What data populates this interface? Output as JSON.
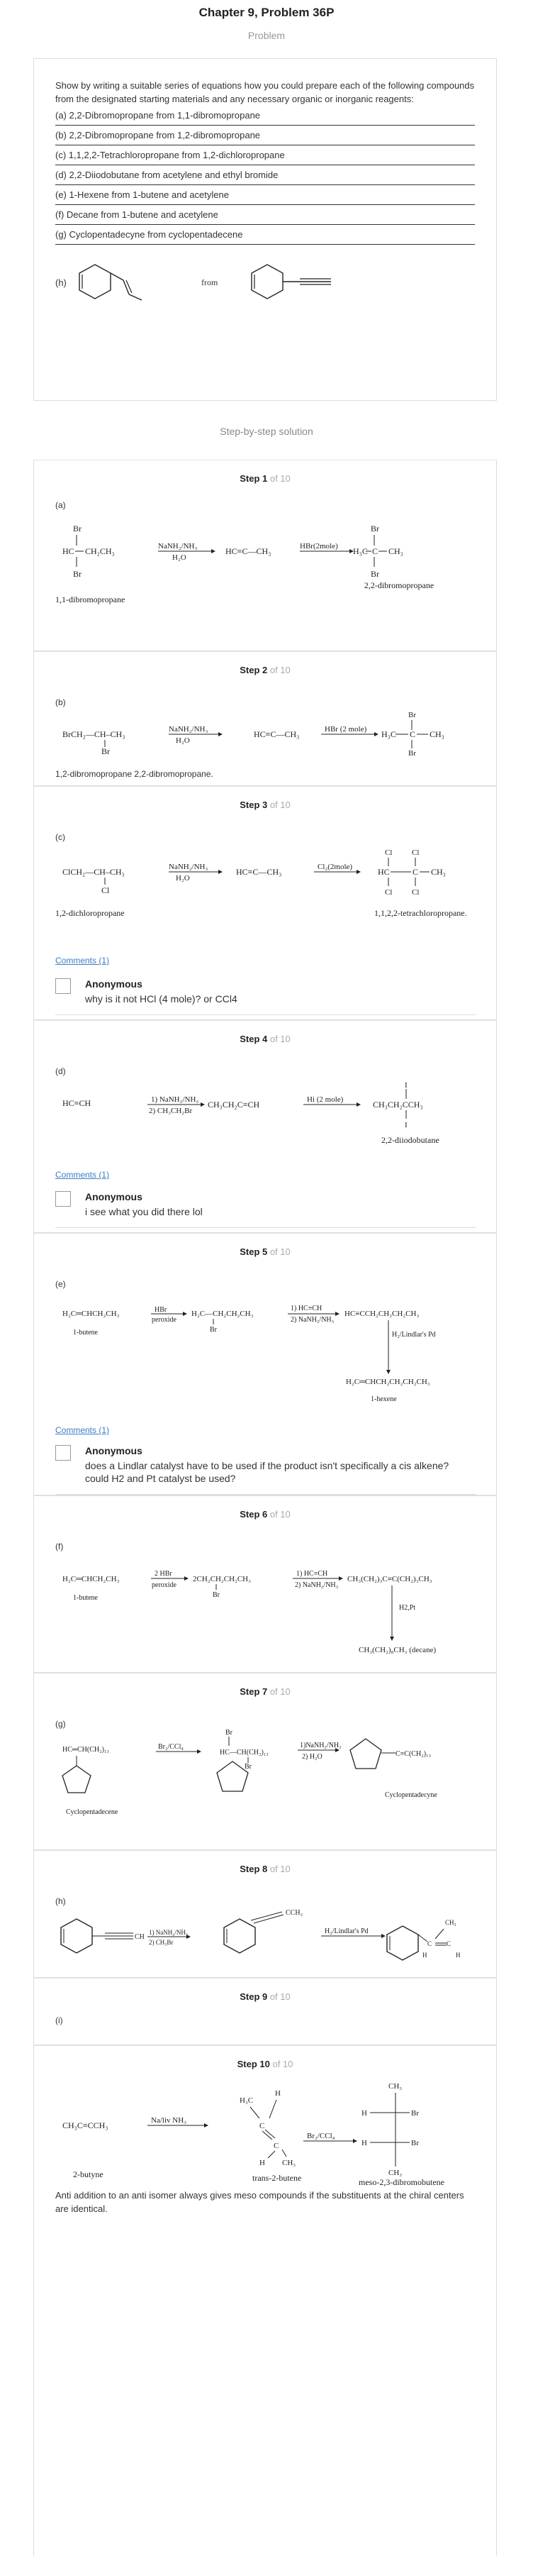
{
  "header": {
    "title": "Chapter 9, Problem 36P",
    "subtitle": "Problem"
  },
  "problem": {
    "intro": "Show by writing a suitable series of equations how you could prepare each of the following compounds from the designated starting materials and any necessary organic or inorganic reagents:",
    "questions": [
      "(a) 2,2-Dibromopropane from 1,1-dibromopropane",
      "(b) 2,2-Dibromopropane from 1,2-dibromopropane",
      "(c) 1,1,2,2-Tetrachloropropane from 1,2-dichloropropane",
      "(d) 2,2-Diiodobutane from acetylene and ethyl bromide",
      "(e) 1-Hexene from 1-butene and acetylene",
      "(f) Decane from 1-butene and acetylene",
      "(g) Cyclopentadecyne from cyclopentadecene"
    ],
    "h_label": "(h)",
    "h_from": "from"
  },
  "solution_title": "Step-by-step solution",
  "steps": [
    {
      "num": "Step 1",
      "of": " of 10",
      "part": "(a)"
    },
    {
      "num": "Step 2",
      "of": " of 10",
      "part": "(b)"
    },
    {
      "num": "Step 3",
      "of": " of 10",
      "part": "(c)"
    },
    {
      "num": "Step 4",
      "of": " of 10",
      "part": "(d)"
    },
    {
      "num": "Step 5",
      "of": " of 10",
      "part": "(e)"
    },
    {
      "num": "Step 6",
      "of": " of 10",
      "part": "(f)"
    },
    {
      "num": "Step 7",
      "of": " of 10",
      "part": "(g)"
    },
    {
      "num": "Step 8",
      "of": " of 10",
      "part": "(h)"
    },
    {
      "num": "Step 9",
      "of": " of 10",
      "part": "(i)"
    },
    {
      "num": "Step 10",
      "of": " of 10",
      "part": ""
    }
  ],
  "step1": {
    "reagent1_top": "NaNH₂/NH₃",
    "reagent1_bottom": "H₂O",
    "reagent2": "HBr(2mole)",
    "start_name": "1,1-dibromopropane",
    "end_name": "2,2-dibromopropane",
    "br": "Br",
    "hc": "HC",
    "chain": "CH₂CH₃",
    "alkyne": "HC≡C—CH₃",
    "h3c": "H₃C",
    "c": "C",
    "ch3": "CH₃"
  },
  "step2": {
    "start": "BrCH₂—CH–CH₃",
    "br": "Br",
    "reagent1_top": "NaNH₂/NH₃",
    "reagent1_bottom": "H₂O",
    "alkyne": "HC≡C—CH₃",
    "reagent2": "HBr (2 mole)",
    "h3c": "H₃C",
    "c": "C",
    "ch3": "CH₃",
    "caption": "1,2-dibromopropane 2,2-dibromopropane."
  },
  "step3": {
    "start": "ClCH₂—CH–CH₃",
    "cl": "Cl",
    "reagent1_top": "NaNH₂/NH₃",
    "reagent1_bottom": "H₂O",
    "alkyne": "HC≡C—CH₃",
    "reagent2": "Cl₂(2mole)",
    "hc": "HC",
    "c": "C",
    "ch3": "CH₃",
    "start_name": "1,2-dichloropropane",
    "end_name": "1,1,2,2-tetrachloropropane.",
    "comments_link": "Comments (1)",
    "comment_author": "Anonymous",
    "comment_text": "why is it not HCl (4 mole)? or CCl4"
  },
  "step4": {
    "start": "HC≡CH",
    "reagent1_top": "1) NaNH₂/NH₃",
    "reagent1_bottom": "2) CH₃CH₂Br",
    "mid": "CH₃CH₂C≡CH",
    "reagent2": "Hi (2 mole)",
    "product": "CH₃CH₂CCH₃",
    "i": "I",
    "end_name": "2,2-diiodobutane",
    "comments_link": "Comments (1)",
    "comment_author": "Anonymous",
    "comment_text": "i see what you did there lol"
  },
  "step5": {
    "start": "H₂C═CHCH₂CH₃",
    "start_name": "1-butene",
    "reagent1_top": "HBr",
    "reagent1_bottom": "peroxide",
    "mid": "H₂C—CH₂CH₂CH₃",
    "br": "Br",
    "reagent2_top": "1) HC≡CH",
    "reagent2_bottom": "2) NaNH₂/NH₃",
    "alkyne": "HC≡CCH₂CH₂CH₂CH₃",
    "reagent3": "H₂/Lindlar's Pd",
    "product": "H₂C═CHCH₂CH₂CH₂CH₃",
    "end_name": "1-hexene",
    "comments_link": "Comments (1)",
    "comment_author": "Anonymous",
    "comment_text": "does a Lindlar catalyst have to be used if the product isn't specifically a cis alkene? could H2 and Pt catalyst be used?"
  },
  "step6": {
    "start": "H₂C═CHCH₂CH₃",
    "start_name": "1-butene",
    "reagent1_top": "2 HBr",
    "reagent1_bottom": "peroxide",
    "mid": "2CH₂CH₂CH₂CH₃",
    "br": "Br",
    "reagent2_top": "1) HC≡CH",
    "reagent2_bottom": "2) NaNH₂/NH₃",
    "alkyne": "CH₃(CH₂)₃C≡C(CH₂)₃CH₃",
    "reagent3": "H2,Pt",
    "product": "CH₃(CH₂)₈CH₃   (decane)"
  },
  "step7": {
    "start": "HC═CH(CH₂)₁₃",
    "start_name": "Cyclopentadecene",
    "reagent1": "Br₂/CCl₄",
    "mid": "HC—CH(CH₂)₁₃",
    "br": "Br",
    "reagent2_top": "1)NaNH₂/NH₃",
    "reagent2_bottom": "2) H₂O",
    "product": "C≡C(CH₂)₁₃",
    "end_name": "Cyclopentadecyne"
  },
  "step8": {
    "reagent1_top": "1) NaNH₂/NH₃",
    "reagent1_bottom": "2) CH₃Br",
    "ch": "CH",
    "mid": "CCH₃",
    "reagent2": "H₂/Lindlar's Pd",
    "ch3": "CH₃",
    "c": "C",
    "h": "H"
  },
  "step10": {
    "start": "CH₃C≡CCH₃",
    "start_name": "2-butyne",
    "reagent1": "Na/liv NH₃",
    "h3c": "H₃C",
    "h": "H",
    "c": "C",
    "ch3": "CH₃",
    "mid_name": "trans-2-butene",
    "reagent2": "Br₂/CCl₄",
    "br": "Br",
    "end_name": "meso-2,3-dibromobutene",
    "note": "Anti addition to an anti isomer always gives meso compounds if the substituents at the chiral centers are identical."
  }
}
